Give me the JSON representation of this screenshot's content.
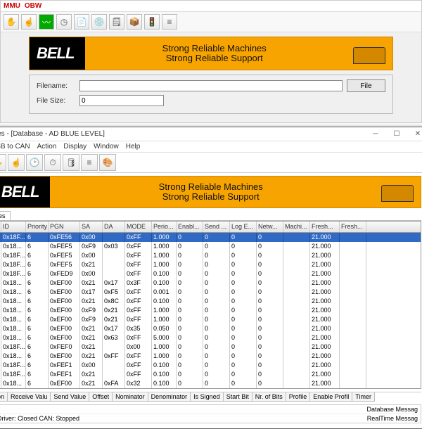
{
  "upper": {
    "menu": {
      "mmu": "MMU",
      "obw": "OBW"
    },
    "banner": {
      "logo": "BELL",
      "slogan1": "Strong Reliable Machines",
      "slogan2": "Strong Reliable Support"
    },
    "file": {
      "filename_label": "Filename:",
      "filesize_label": "File Size:",
      "filename_value": "",
      "filesize_value": "0",
      "file_btn": "File"
    }
  },
  "lower": {
    "title": "eries - [Database - AD BLUE LEVEL]",
    "menu": {
      "usb": "USB to CAN",
      "action": "Action",
      "display": "Display",
      "window": "Window",
      "help": "Help"
    },
    "banner": {
      "logo": "BELL",
      "slogan1": "Strong Reliable Machines",
      "slogan2": "Strong Reliable Support"
    },
    "tab": "es",
    "columns": {
      "id": "ID",
      "pri": "Priority",
      "pgn": "PGN",
      "sa": "SA",
      "da": "DA",
      "mode": "MODE",
      "perio": "Perio...",
      "enabl": "Enabl...",
      "send": "Send ...",
      "loge": "Log E...",
      "netw": "Netw...",
      "machi": "Machi...",
      "fresh": "Fresh...",
      "fresh2": "Fresh..."
    },
    "rows": [
      {
        "id": "0x18F...",
        "pri": "6",
        "pgn": "0xFE56",
        "sa": "0x00",
        "da": "",
        "mode": "0xFF",
        "perio": "1.000",
        "enabl": "0",
        "send": "0",
        "loge": "0",
        "netw": "0",
        "machi": "",
        "fresh": "21.000",
        "fresh2": "",
        "selected": true
      },
      {
        "id": "0x18...",
        "pri": "6",
        "pgn": "0xFEF5",
        "sa": "0xF9",
        "da": "0x03",
        "mode": "0xFF",
        "perio": "1.000",
        "enabl": "0",
        "send": "0",
        "loge": "0",
        "netw": "0",
        "machi": "",
        "fresh": "21.000",
        "fresh2": ""
      },
      {
        "id": "0x18F...",
        "pri": "6",
        "pgn": "0xFEF5",
        "sa": "0x00",
        "da": "",
        "mode": "0xFF",
        "perio": "1.000",
        "enabl": "0",
        "send": "0",
        "loge": "0",
        "netw": "0",
        "machi": "",
        "fresh": "21.000",
        "fresh2": ""
      },
      {
        "id": "0x18F...",
        "pri": "6",
        "pgn": "0xFEF5",
        "sa": "0x21",
        "da": "",
        "mode": "0xFF",
        "perio": "1.000",
        "enabl": "0",
        "send": "0",
        "loge": "0",
        "netw": "0",
        "machi": "",
        "fresh": "21.000",
        "fresh2": ""
      },
      {
        "id": "0x18F...",
        "pri": "6",
        "pgn": "0xFED9",
        "sa": "0x00",
        "da": "",
        "mode": "0xFF",
        "perio": "0.100",
        "enabl": "0",
        "send": "0",
        "loge": "0",
        "netw": "0",
        "machi": "",
        "fresh": "21.000",
        "fresh2": ""
      },
      {
        "id": "0x18...",
        "pri": "6",
        "pgn": "0xEF00",
        "sa": "0x21",
        "da": "0x17",
        "mode": "0x3F",
        "perio": "0.100",
        "enabl": "0",
        "send": "0",
        "loge": "0",
        "netw": "0",
        "machi": "",
        "fresh": "21.000",
        "fresh2": ""
      },
      {
        "id": "0x18...",
        "pri": "6",
        "pgn": "0xEF00",
        "sa": "0x17",
        "da": "0xF5",
        "mode": "0xFF",
        "perio": "0.001",
        "enabl": "0",
        "send": "0",
        "loge": "0",
        "netw": "0",
        "machi": "",
        "fresh": "21.000",
        "fresh2": ""
      },
      {
        "id": "0x18...",
        "pri": "6",
        "pgn": "0xEF00",
        "sa": "0x21",
        "da": "0x8C",
        "mode": "0xFF",
        "perio": "0.100",
        "enabl": "0",
        "send": "0",
        "loge": "0",
        "netw": "0",
        "machi": "",
        "fresh": "21.000",
        "fresh2": ""
      },
      {
        "id": "0x18...",
        "pri": "6",
        "pgn": "0xEF00",
        "sa": "0xF9",
        "da": "0x21",
        "mode": "0xFF",
        "perio": "1.000",
        "enabl": "0",
        "send": "0",
        "loge": "0",
        "netw": "0",
        "machi": "",
        "fresh": "21.000",
        "fresh2": ""
      },
      {
        "id": "0x18...",
        "pri": "6",
        "pgn": "0xEF00",
        "sa": "0xF9",
        "da": "0x21",
        "mode": "0xFF",
        "perio": "1.000",
        "enabl": "0",
        "send": "0",
        "loge": "0",
        "netw": "0",
        "machi": "",
        "fresh": "21.000",
        "fresh2": ""
      },
      {
        "id": "0x18...",
        "pri": "6",
        "pgn": "0xEF00",
        "sa": "0x21",
        "da": "0x17",
        "mode": "0x35",
        "perio": "0.050",
        "enabl": "0",
        "send": "0",
        "loge": "0",
        "netw": "0",
        "machi": "",
        "fresh": "21.000",
        "fresh2": ""
      },
      {
        "id": "0x18...",
        "pri": "6",
        "pgn": "0xEF00",
        "sa": "0x21",
        "da": "0x63",
        "mode": "0xFF",
        "perio": "5.000",
        "enabl": "0",
        "send": "0",
        "loge": "0",
        "netw": "0",
        "machi": "",
        "fresh": "21.000",
        "fresh2": ""
      },
      {
        "id": "0x18F...",
        "pri": "6",
        "pgn": "0xFEF0",
        "sa": "0x21",
        "da": "",
        "mode": "0x00",
        "perio": "1.000",
        "enabl": "0",
        "send": "0",
        "loge": "0",
        "netw": "0",
        "machi": "",
        "fresh": "21.000",
        "fresh2": ""
      },
      {
        "id": "0x18...",
        "pri": "6",
        "pgn": "0xEF00",
        "sa": "0x21",
        "da": "0xFF",
        "mode": "0xFF",
        "perio": "1.000",
        "enabl": "0",
        "send": "0",
        "loge": "0",
        "netw": "0",
        "machi": "",
        "fresh": "21.000",
        "fresh2": ""
      },
      {
        "id": "0x18F...",
        "pri": "6",
        "pgn": "0xFEF1",
        "sa": "0x00",
        "da": "",
        "mode": "0xFF",
        "perio": "0.100",
        "enabl": "0",
        "send": "0",
        "loge": "0",
        "netw": "0",
        "machi": "",
        "fresh": "21.000",
        "fresh2": ""
      },
      {
        "id": "0x18F...",
        "pri": "6",
        "pgn": "0xFEF1",
        "sa": "0x21",
        "da": "",
        "mode": "0xFF",
        "perio": "0.100",
        "enabl": "0",
        "send": "0",
        "loge": "0",
        "netw": "0",
        "machi": "",
        "fresh": "21.000",
        "fresh2": ""
      },
      {
        "id": "0x18...",
        "pri": "6",
        "pgn": "0xEF00",
        "sa": "0x21",
        "da": "0xFA",
        "mode": "0x32",
        "perio": "0.100",
        "enabl": "0",
        "send": "0",
        "loge": "0",
        "netw": "0",
        "machi": "",
        "fresh": "21.000",
        "fresh2": ""
      }
    ],
    "lower_tabs": [
      "on",
      "Receive Valu",
      "Send Value",
      "Offset",
      "Nominator",
      "Denominator",
      "Is Signed",
      "Start Bit",
      "Nr. of Bits",
      "Profile",
      "Enable Profil",
      "Timer"
    ],
    "status": {
      "r1_left": ":",
      "r1_right": "Database Messag",
      "r2_left": "Driver: Closed      CAN: Stopped",
      "r2_right": "RealTime Messag"
    }
  }
}
